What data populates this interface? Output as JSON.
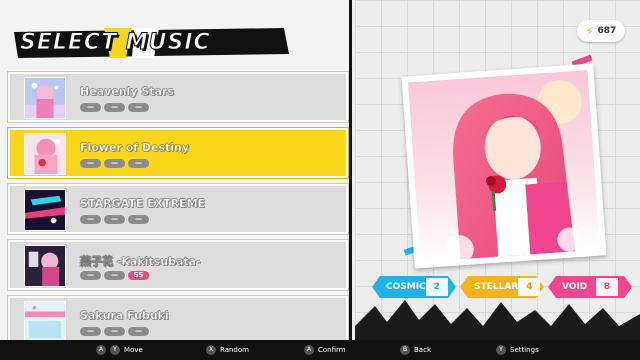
{
  "header": {
    "title": "SELECT MUSIC",
    "currency_value": "687",
    "currency_icon": "bolt-icon"
  },
  "songs": [
    {
      "title": "Heavenly Stars",
      "pills": [
        "—",
        "—",
        "—"
      ],
      "selected": false
    },
    {
      "title": "Flower of Destiny",
      "pills": [
        "—",
        "—",
        "—"
      ],
      "selected": true
    },
    {
      "title": "STARGATE EXTREME",
      "pills": [
        "—",
        "—",
        "—"
      ],
      "selected": false
    },
    {
      "title": "燕子花 -Kakitsubata-",
      "pills": [
        "—",
        "—",
        "SS"
      ],
      "selected": false
    },
    {
      "title": "Sakura Fubuki",
      "pills": [
        "—",
        "—",
        "—"
      ],
      "selected": false
    }
  ],
  "difficulties": [
    {
      "name": "COSMIC",
      "level": "2",
      "color": "#1fb3e8"
    },
    {
      "name": "STELLAR",
      "level": "4",
      "color": "#f6b21b"
    },
    {
      "name": "VOID",
      "level": "8",
      "color": "#f0458f"
    }
  ],
  "controls": [
    {
      "buttons": [
        "A",
        "Y"
      ],
      "label": "Move"
    },
    {
      "buttons": [
        "X"
      ],
      "label": "Random"
    },
    {
      "buttons": [
        "A"
      ],
      "label": "Confirm"
    },
    {
      "buttons": [
        "B"
      ],
      "label": "Back"
    },
    {
      "buttons": [
        "Y"
      ],
      "label": "Settings"
    }
  ],
  "colors": {
    "selected_row": "#f9d51c",
    "pill_gray": "#8c8c8c",
    "pill_ss": "#e84a8c"
  }
}
